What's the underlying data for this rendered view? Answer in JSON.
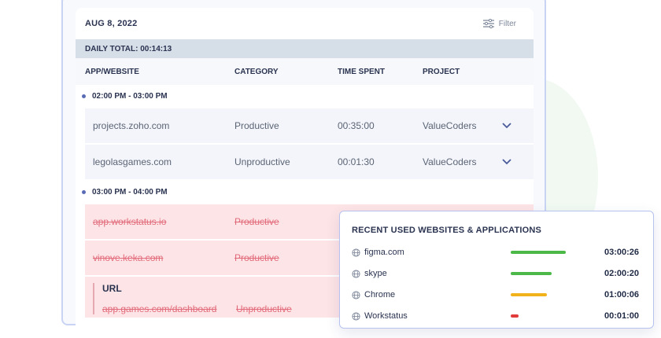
{
  "panel": {
    "date": "AUG 8, 2022",
    "filter_label": "Filter",
    "daily_total": "DAILY TOTAL: 00:14:13",
    "columns": [
      "APP/WEBSITE",
      "CATEGORY",
      "TIME SPENT",
      "PROJECT"
    ],
    "slots": [
      {
        "time": "02:00 PM - 03:00 PM",
        "rows": [
          {
            "app": "projects.zoho.com",
            "category": "Productive",
            "time": "00:35:00",
            "project": "ValueCoders"
          },
          {
            "app": "legolasgames.com",
            "category": "Unproductive",
            "time": "00:01:30",
            "project": "ValueCoders"
          }
        ]
      },
      {
        "time": "03:00 PM - 04:00 PM",
        "rows": [
          {
            "app": "app.workstatus.io",
            "category": "Productive"
          },
          {
            "app": "vinove.keka.com",
            "category": "Productive"
          }
        ]
      }
    ],
    "url_block": {
      "title": "URL",
      "url": "app.games.com/dashboard",
      "category": "Unproductive"
    }
  },
  "recent": {
    "title": "RECENT USED WEBSITES & APPLICATIONS",
    "items": [
      {
        "name": "figma.com",
        "time": "03:00:26",
        "bar_color": "#4cb848",
        "share": 0.7
      },
      {
        "name": "skype",
        "time": "02:00:20",
        "bar_color": "#4cb848",
        "share": 0.52
      },
      {
        "name": "Chrome",
        "time": "01:00:06",
        "bar_color": "#f2b21c",
        "share": 0.46
      },
      {
        "name": "Workstatus",
        "time": "00:01:00",
        "bar_color": "#e23b3b",
        "share": 0.1
      }
    ]
  }
}
